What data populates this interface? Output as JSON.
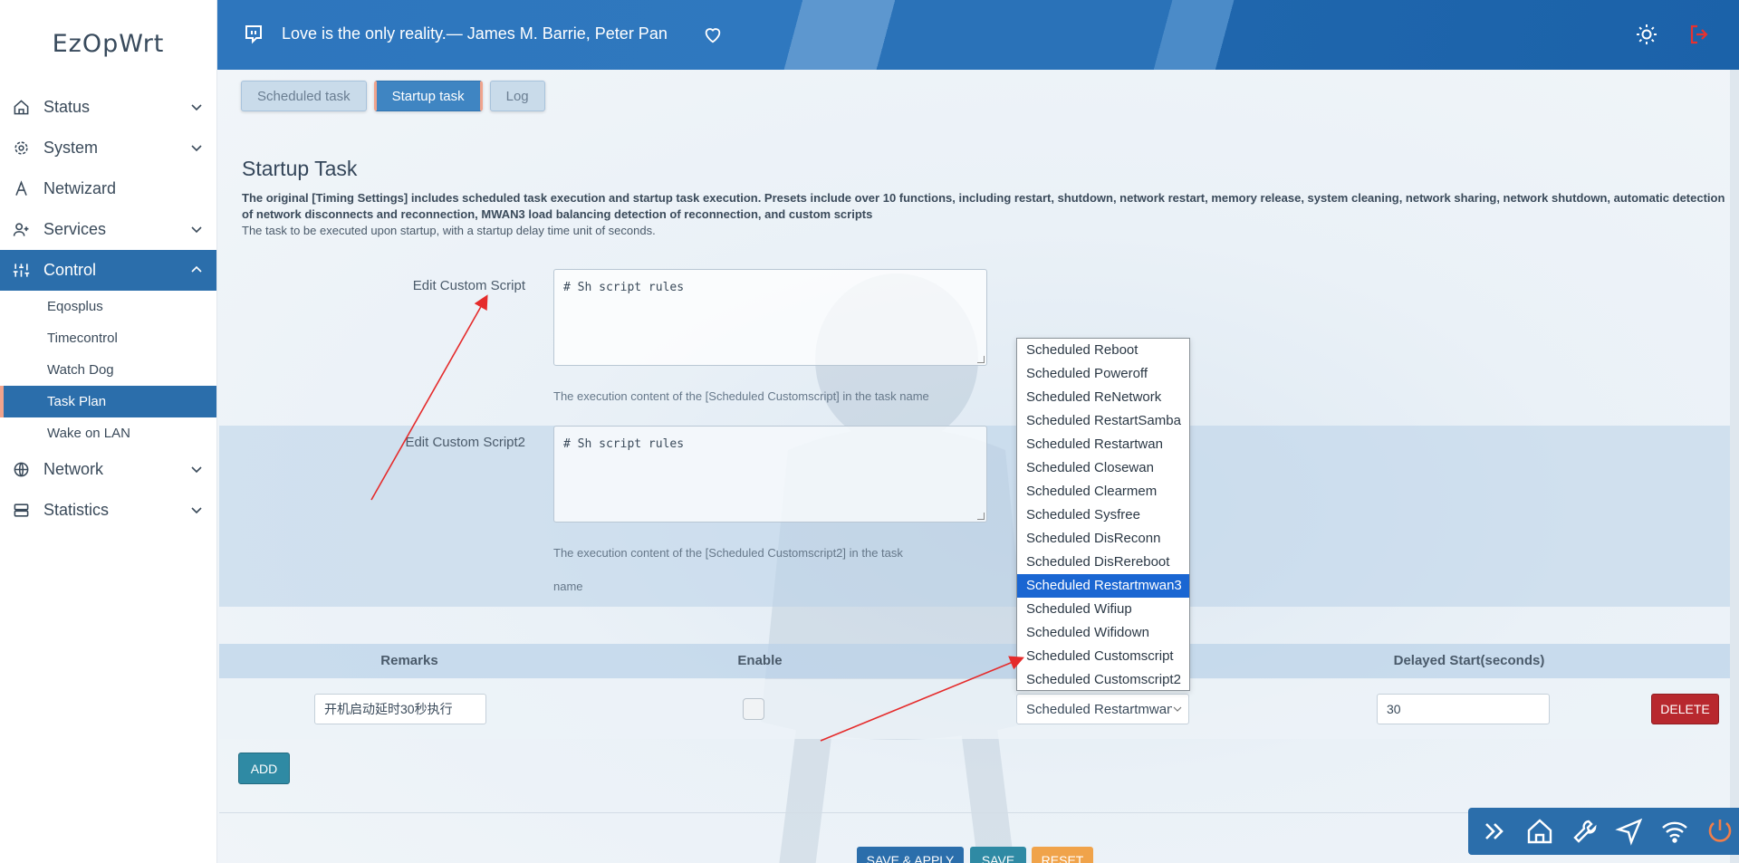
{
  "brand": "EzOpWrt",
  "header": {
    "quote": "Love is the only reality.— James M. Barrie, Peter Pan"
  },
  "sidebar": {
    "items": [
      {
        "label": "Status"
      },
      {
        "label": "System"
      },
      {
        "label": "Netwizard"
      },
      {
        "label": "Services"
      },
      {
        "label": "Control"
      },
      {
        "label": "Network"
      },
      {
        "label": "Statistics"
      }
    ],
    "control_sub": [
      {
        "label": "Eqosplus"
      },
      {
        "label": "Timecontrol"
      },
      {
        "label": "Watch Dog"
      },
      {
        "label": "Task Plan"
      },
      {
        "label": "Wake on LAN"
      }
    ]
  },
  "tabs": [
    {
      "label": "Scheduled task"
    },
    {
      "label": "Startup task"
    },
    {
      "label": "Log"
    }
  ],
  "section": {
    "title": "Startup Task",
    "description": "The original [Timing Settings] includes scheduled task execution and startup task execution. Presets include over 10 functions, including restart, shutdown, network restart, memory release, system cleaning, network sharing, network shutdown, automatic detection of network disconnects and reconnection, MWAN3 load balancing detection of reconnection, and custom scripts",
    "subdescription": "The task to be executed upon startup, with a startup delay time unit of seconds."
  },
  "fields": {
    "script1": {
      "label": "Edit Custom Script",
      "value": "# Sh script rules",
      "hint": "The execution content of the [Scheduled Customscript] in the task name"
    },
    "script2": {
      "label": "Edit Custom Script2",
      "value": "# Sh script rules",
      "hint_line1": "The execution content of the [Scheduled Customscript2] in the task",
      "hint_line2": "name"
    }
  },
  "table": {
    "headers": {
      "remarks": "Remarks",
      "enable": "Enable",
      "delay": "Delayed Start(seconds)"
    },
    "row": {
      "remarks": "开机启动延时30秒执行",
      "task": "Scheduled Restartmwan3",
      "delay": "30",
      "delete_label": "DELETE"
    }
  },
  "dropdown_options": [
    "Scheduled Reboot",
    "Scheduled Poweroff",
    "Scheduled ReNetwork",
    "Scheduled RestartSamba",
    "Scheduled Restartwan",
    "Scheduled Closewan",
    "Scheduled Clearmem",
    "Scheduled Sysfree",
    "Scheduled DisReconn",
    "Scheduled DisRereboot",
    "Scheduled Restartmwan3",
    "Scheduled Wifiup",
    "Scheduled Wifidown",
    "Scheduled Customscript",
    "Scheduled Customscript2"
  ],
  "dropdown_selected_index": 10,
  "buttons": {
    "add": "ADD",
    "save_apply": "SAVE & APPLY",
    "save": "SAVE",
    "reset": "RESET"
  },
  "colors": {
    "primary": "#2b6eab",
    "danger": "#b8282e",
    "accent": "#f0a38c",
    "annotation": "#e52b2b"
  }
}
